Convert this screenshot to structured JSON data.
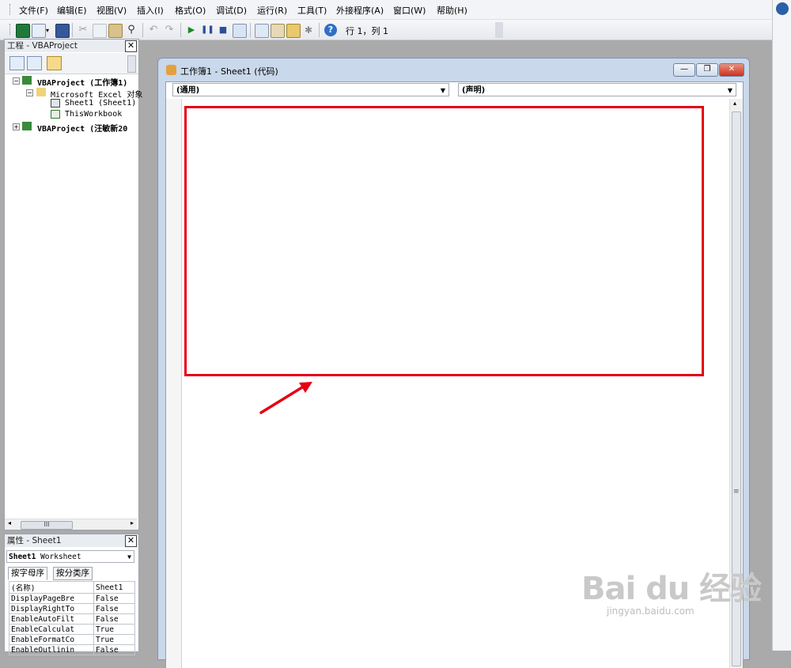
{
  "menu": {
    "items": [
      "文件(F)",
      "编辑(E)",
      "视图(V)",
      "插入(I)",
      "格式(O)",
      "调试(D)",
      "运行(R)",
      "工具(T)",
      "外接程序(A)",
      "窗口(W)",
      "帮助(H)"
    ]
  },
  "toolbar": {
    "caret_position": "行 1，列 1"
  },
  "project_pane": {
    "title": "工程 - VBAProject",
    "close_glyph": "✕",
    "tree": [
      {
        "label": "VBAProject (工作簿1)",
        "indent": 0,
        "bold": true
      },
      {
        "label": "Microsoft Excel 对象",
        "indent": 1,
        "bold": false
      },
      {
        "label": "Sheet1 (Sheet1)",
        "indent": 2,
        "bold": false
      },
      {
        "label": "ThisWorkbook",
        "indent": 2,
        "bold": false
      },
      {
        "label": "VBAProject (汪敏新20",
        "indent": 0,
        "bold": true
      }
    ],
    "scroll_thumb": "III"
  },
  "properties_pane": {
    "title": "属性 - Sheet1",
    "close_glyph": "✕",
    "object_name": "Sheet1",
    "object_type": "Worksheet",
    "tabs": [
      "按字母序",
      "按分类序"
    ],
    "rows": [
      {
        "name": "(名称)",
        "value": "Sheet1"
      },
      {
        "name": "DisplayPageBre",
        "value": "False"
      },
      {
        "name": "DisplayRightTo",
        "value": "False"
      },
      {
        "name": "EnableAutoFilt",
        "value": "False"
      },
      {
        "name": "EnableCalculat",
        "value": "True"
      },
      {
        "name": "EnableFormatCo",
        "value": "True"
      },
      {
        "name": "EnableOutlinin",
        "value": "False"
      }
    ]
  },
  "code_window": {
    "title": "工作簿1 - Sheet1 (代码)",
    "object_combo": "(通用)",
    "procedure_combo": "(声明)",
    "minimize_glyph": "—",
    "restore_glyph": "❐",
    "close_glyph": "✕"
  },
  "watermark": {
    "main": "Bai du 经验",
    "sub": "jingyan.baidu.com"
  },
  "colors": {
    "highlight": "#e60012",
    "window_frame": "#c9d8ea",
    "close_button": "#d9483b"
  }
}
